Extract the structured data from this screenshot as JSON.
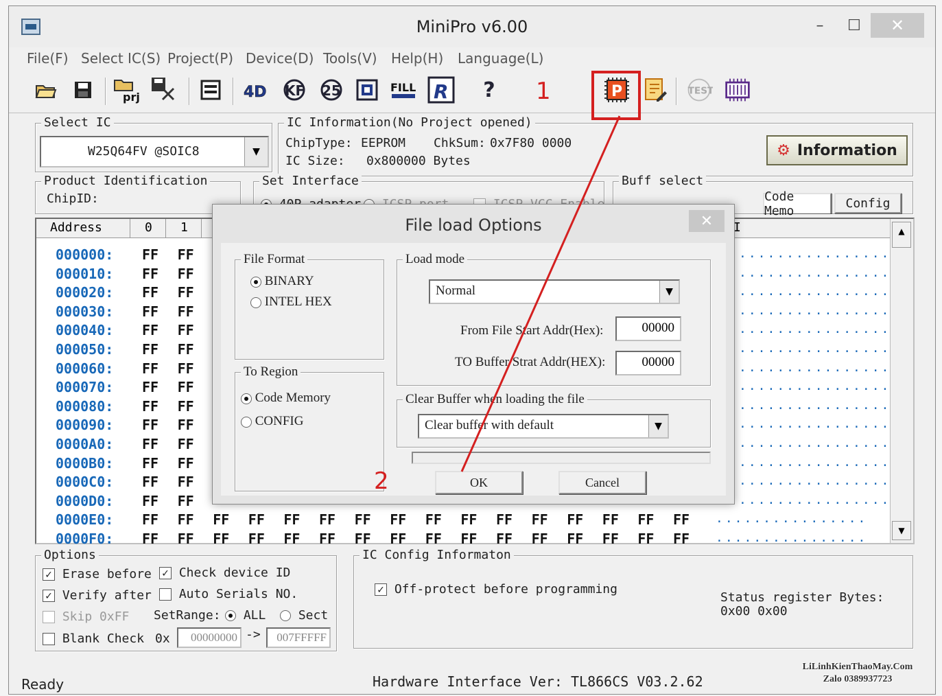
{
  "window": {
    "title": "MiniPro v6.00",
    "min": "–",
    "max": "☐",
    "close": "✕"
  },
  "menu": [
    "File(F)",
    "Select IC(S)",
    "Project(P)",
    "Device(D)",
    "Tools(V)",
    "Help(H)",
    "Language(L)"
  ],
  "toolbar": {
    "buttons": [
      "open-icon",
      "save-icon",
      "open-project-icon",
      "save-project-icon",
      "chip-info-icon",
      "read-icon",
      "verify-icon",
      "blank-check-icon",
      "encrypt-icon",
      "fill-icon",
      "read-id-icon",
      "help-icon",
      "program-icon",
      "edit-icon",
      "test-icon",
      "chip-icon"
    ],
    "labels": {
      "prj": "prj",
      "read": "4D",
      "fill": "FILL",
      "r": "R",
      "help": "?",
      "p": "P",
      "test": "TEST"
    },
    "annotation": "1"
  },
  "select_ic": {
    "label": "Select IC",
    "value": "W25Q64FV @SOIC8"
  },
  "ic_info": {
    "label": "IC Information(No Project opened)",
    "chip_type_label": "ChipType:",
    "chip_type": "EEPROM",
    "chksum_label": "ChkSum:",
    "chksum": "0x7F80 0000",
    "size_label": "IC Size:",
    "size": "0x800000 Bytes"
  },
  "info_button": "Information",
  "product_id": {
    "label": "Product Identification",
    "chip_id_label": "ChipID:"
  },
  "set_interface": {
    "label": "Set Interface",
    "opt1": "40P adapter",
    "opt2": "ICSP port",
    "opt3": "ICSP VCC Enable"
  },
  "buff_select": {
    "label": "Buff select",
    "tabs": [
      "Code Memo",
      "Config"
    ]
  },
  "hex": {
    "header": {
      "address": "Address",
      "col0": "0",
      "col1": "1",
      "tail": "I"
    },
    "rows": [
      "000000:",
      "000010:",
      "000020:",
      "000030:",
      "000040:",
      "000050:",
      "000060:",
      "000070:",
      "000080:",
      "000090:",
      "0000A0:",
      "0000B0:",
      "0000C0:",
      "0000D0:",
      "0000E0:",
      "0000F0:"
    ],
    "value": "FF",
    "ascii": "................"
  },
  "dialog": {
    "title": "File load Options",
    "close": "✕",
    "file_format": {
      "label": "File Format",
      "binary": "BINARY",
      "intel": "INTEL HEX"
    },
    "load_mode": {
      "label": "Load mode",
      "value": "Normal",
      "from_label": "From File Start Addr(Hex):",
      "from_value": "00000",
      "to_label": "TO Buffer Strat Addr(HEX):",
      "to_value": "00000"
    },
    "to_region": {
      "label": "To Region",
      "code": "Code Memory",
      "config": "CONFIG"
    },
    "clear_buffer": {
      "label": "Clear Buffer when loading the file",
      "value": "Clear buffer with default"
    },
    "ok": "OK",
    "cancel": "Cancel",
    "annotation": "2"
  },
  "options": {
    "label": "Options",
    "erase": "Erase before",
    "check_id": "Check device ID",
    "verify": "Verify after",
    "auto_serials": "Auto Serials NO.",
    "skip": "Skip 0xFF",
    "setrange": "SetRange:",
    "all": "ALL",
    "sect": "Sect",
    "blank": "Blank Check",
    "ox": "0x",
    "range_from": "00000000",
    "arrow": "->",
    "range_to": "007FFFFF"
  },
  "ic_config": {
    "label": "IC Config Informaton",
    "off_protect": "Off-protect before programming",
    "status_label": "Status register Bytes:",
    "status_values": "0x00 0x00"
  },
  "status": {
    "ready": "Ready",
    "hw": "Hardware Interface Ver: TL866CS V03.2.62"
  },
  "watermark": {
    "line1": "LiLinhKienThaoMay.Com",
    "line2": "Zalo 0389937723"
  },
  "colors": {
    "annotation_red": "#d42020",
    "address_blue": "#1868b8"
  }
}
